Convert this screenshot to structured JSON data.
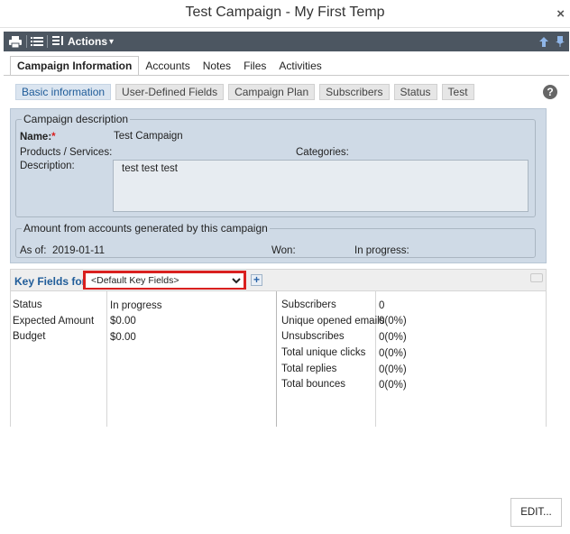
{
  "window": {
    "title": "Test Campaign - My First Temp",
    "close_glyph": "×"
  },
  "toolbar": {
    "actions_label": "Actions",
    "icons": [
      "print-icon",
      "list-icon",
      "columns-icon",
      "up-arrow-icon",
      "pin-icon"
    ]
  },
  "tabs": [
    "Campaign Information",
    "Accounts",
    "Notes",
    "Files",
    "Activities"
  ],
  "subtabs": [
    "Basic information",
    "User-Defined Fields",
    "Campaign Plan",
    "Subscribers",
    "Status",
    "Test"
  ],
  "help_glyph": "?",
  "description": {
    "legend": "Campaign description",
    "name_label": "Name:",
    "required_mark": "*",
    "name_value": "Test Campaign",
    "products_label": "Products / Services:",
    "categories_label": "Categories:",
    "description_label": "Description:",
    "description_value": "test test test"
  },
  "amount": {
    "legend": "Amount from accounts generated by this campaign",
    "as_of_label": "As of:",
    "as_of_value": "2019-01-11",
    "won_label": "Won:",
    "in_progress_label": "In progress:"
  },
  "key_fields": {
    "label": "Key Fields for:",
    "selected": "<Default Key Fields>",
    "plus_glyph": "+",
    "left": [
      {
        "label": "Status",
        "value": "In progress"
      },
      {
        "label": "Expected Amount",
        "value": "$0.00"
      },
      {
        "label": "Budget",
        "value": "$0.00"
      }
    ],
    "right": [
      {
        "label": "Subscribers",
        "value": "0"
      },
      {
        "label": "Unique opened emails",
        "value": "0(0%)"
      },
      {
        "label": "Unsubscribes",
        "value": "0(0%)"
      },
      {
        "label": "Total unique clicks",
        "value": "0(0%)"
      },
      {
        "label": "Total replies",
        "value": "0(0%)"
      },
      {
        "label": "Total bounces",
        "value": "0(0%)"
      }
    ]
  },
  "edit_label": "EDIT...",
  "colors": {
    "toolbar": "#4c5661",
    "panel": "#cfdae6",
    "accent": "#1f5c99",
    "highlight": "#d9201f"
  }
}
